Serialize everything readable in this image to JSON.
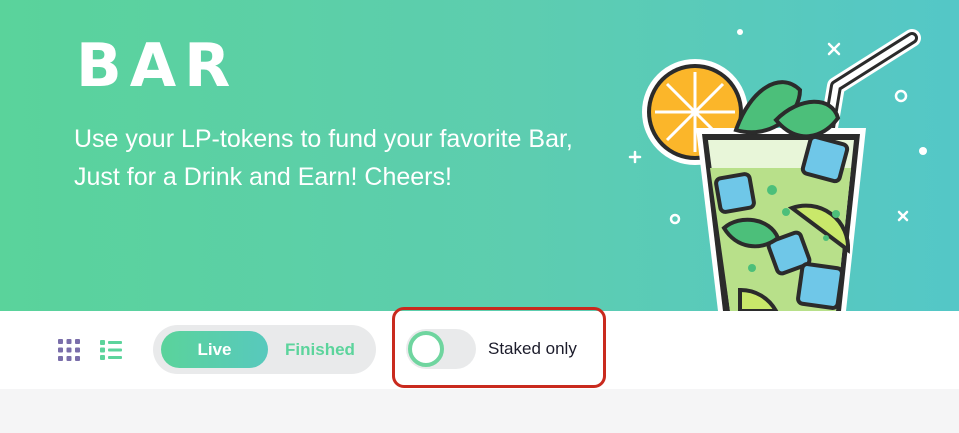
{
  "hero": {
    "title": "BAR",
    "subtitle_line1": "Use your LP-tokens to fund your favorite Bar,",
    "subtitle_line2": "Just for a Drink and Earn! Cheers!"
  },
  "toolbar": {
    "view_modes": [
      {
        "name": "grid-view",
        "icon": "grid-icon"
      },
      {
        "name": "list-view",
        "icon": "list-icon"
      }
    ],
    "tabs": [
      {
        "label": "Live",
        "active": true
      },
      {
        "label": "Finished",
        "active": false
      }
    ],
    "staked_only": {
      "label": "Staked only",
      "checked": false
    }
  },
  "colors": {
    "accent": "#5cd49c",
    "accent_teal": "#54c7c7",
    "highlight": "#c92a1e",
    "text_dark": "#1c1c2b"
  }
}
